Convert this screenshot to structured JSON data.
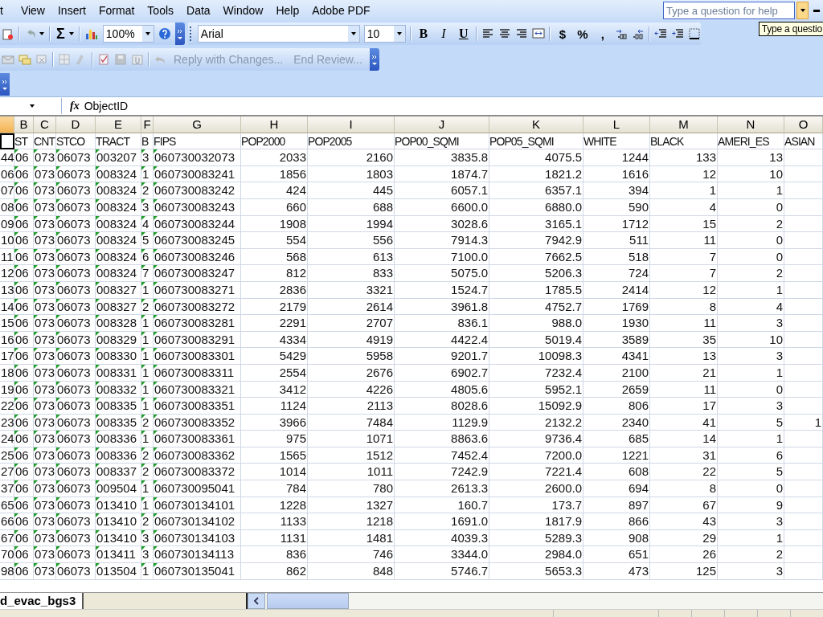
{
  "menu": [
    "t",
    "View",
    "Insert",
    "Format",
    "Tools",
    "Data",
    "Window",
    "Help",
    "Adobe PDF"
  ],
  "help_box": {
    "placeholder": "Type a question for help"
  },
  "tooltip": "Type a questio",
  "standard_toolbar": {
    "sum": "Σ",
    "zoom": "100%"
  },
  "formatting_toolbar": {
    "font": "Arial",
    "size": "10",
    "styles": [
      {
        "label": "B",
        "kind": "bold"
      },
      {
        "label": "I",
        "kind": "italic"
      },
      {
        "label": "U",
        "kind": "underline"
      }
    ],
    "symbols": [
      "$",
      "%",
      ","
    ]
  },
  "review_toolbar": {
    "buttons": [
      {
        "label": "Reply with Changes...",
        "disabled": true
      },
      {
        "label": "End Review...",
        "disabled": true
      }
    ]
  },
  "formula_bar": {
    "function_label": "fx",
    "value": "ObjectID"
  },
  "columns": [
    {
      "selected": true,
      "text_format": false
    },
    {
      "letter": "B",
      "selected": false,
      "text_format": true
    },
    {
      "letter": "C",
      "selected": false,
      "text_format": true
    },
    {
      "letter": "D",
      "selected": false,
      "text_format": true
    },
    {
      "letter": "E",
      "selected": false,
      "text_format": true
    },
    {
      "letter": "F",
      "selected": false,
      "text_format": true
    },
    {
      "letter": "G",
      "selected": false,
      "text_format": true
    },
    {
      "letter": "H",
      "selected": false,
      "text_format": false
    },
    {
      "letter": "I",
      "selected": false,
      "text_format": false
    },
    {
      "letter": "J",
      "selected": false,
      "text_format": false
    },
    {
      "letter": "K",
      "selected": false,
      "text_format": false
    },
    {
      "letter": "L",
      "selected": false,
      "text_format": false
    },
    {
      "letter": "M",
      "selected": false,
      "text_format": false
    },
    {
      "letter": "N",
      "selected": false,
      "text_format": false
    },
    {
      "letter": "O",
      "selected": false,
      "text_format": false
    }
  ],
  "header_row": [
    {
      "selected": true
    },
    {
      "text": "ST",
      "selected": false
    },
    {
      "text": "CNT",
      "selected": false
    },
    {
      "text": "STCO",
      "selected": false
    },
    {
      "text": "TRACT",
      "selected": false
    },
    {
      "text": "B",
      "selected": false
    },
    {
      "text": "FIPS",
      "selected": false
    },
    {
      "text": "POP2000",
      "selected": false
    },
    {
      "text": "POP2005",
      "selected": false
    },
    {
      "text": "POP00_SQMI",
      "selected": false
    },
    {
      "text": "POP05_SQMI",
      "selected": false
    },
    {
      "text": "WHITE",
      "selected": false
    },
    {
      "text": "BLACK",
      "selected": false
    },
    {
      "text": "AMERI_ES",
      "selected": false
    },
    {
      "text": "ASIAN",
      "selected": false
    }
  ],
  "rows": [
    [
      "44",
      "06",
      "073",
      "06073",
      "003207",
      "3",
      "060730032073",
      "2033",
      "2160",
      "3835.8",
      "4075.5",
      "1244",
      "133",
      "13"
    ],
    [
      "06",
      "06",
      "073",
      "06073",
      "008324",
      "1",
      "060730083241",
      "1856",
      "1803",
      "1874.7",
      "1821.2",
      "1616",
      "12",
      "10"
    ],
    [
      "07",
      "06",
      "073",
      "06073",
      "008324",
      "2",
      "060730083242",
      "424",
      "445",
      "6057.1",
      "6357.1",
      "394",
      "1",
      "1"
    ],
    [
      "08",
      "06",
      "073",
      "06073",
      "008324",
      "3",
      "060730083243",
      "660",
      "688",
      "6600.0",
      "6880.0",
      "590",
      "4",
      "0"
    ],
    [
      "09",
      "06",
      "073",
      "06073",
      "008324",
      "4",
      "060730083244",
      "1908",
      "1994",
      "3028.6",
      "3165.1",
      "1712",
      "15",
      "2"
    ],
    [
      "10",
      "06",
      "073",
      "06073",
      "008324",
      "5",
      "060730083245",
      "554",
      "556",
      "7914.3",
      "7942.9",
      "511",
      "11",
      "0"
    ],
    [
      "11",
      "06",
      "073",
      "06073",
      "008324",
      "6",
      "060730083246",
      "568",
      "613",
      "7100.0",
      "7662.5",
      "518",
      "7",
      "0"
    ],
    [
      "12",
      "06",
      "073",
      "06073",
      "008324",
      "7",
      "060730083247",
      "812",
      "833",
      "5075.0",
      "5206.3",
      "724",
      "7",
      "2"
    ],
    [
      "13",
      "06",
      "073",
      "06073",
      "008327",
      "1",
      "060730083271",
      "2836",
      "3321",
      "1524.7",
      "1785.5",
      "2414",
      "12",
      "1"
    ],
    [
      "14",
      "06",
      "073",
      "06073",
      "008327",
      "2",
      "060730083272",
      "2179",
      "2614",
      "3961.8",
      "4752.7",
      "1769",
      "8",
      "4"
    ],
    [
      "15",
      "06",
      "073",
      "06073",
      "008328",
      "1",
      "060730083281",
      "2291",
      "2707",
      "836.1",
      "988.0",
      "1930",
      "11",
      "3"
    ],
    [
      "16",
      "06",
      "073",
      "06073",
      "008329",
      "1",
      "060730083291",
      "4334",
      "4919",
      "4422.4",
      "5019.4",
      "3589",
      "35",
      "10"
    ],
    [
      "17",
      "06",
      "073",
      "06073",
      "008330",
      "1",
      "060730083301",
      "5429",
      "5958",
      "9201.7",
      "10098.3",
      "4341",
      "13",
      "3"
    ],
    [
      "18",
      "06",
      "073",
      "06073",
      "008331",
      "1",
      "060730083311",
      "2554",
      "2676",
      "6902.7",
      "7232.4",
      "2100",
      "21",
      "1"
    ],
    [
      "19",
      "06",
      "073",
      "06073",
      "008332",
      "1",
      "060730083321",
      "3412",
      "4226",
      "4805.6",
      "5952.1",
      "2659",
      "11",
      "0"
    ],
    [
      "22",
      "06",
      "073",
      "06073",
      "008335",
      "1",
      "060730083351",
      "1124",
      "2113",
      "8028.6",
      "15092.9",
      "806",
      "17",
      "3"
    ],
    [
      "23",
      "06",
      "073",
      "06073",
      "008335",
      "2",
      "060730083352",
      "3966",
      "7484",
      "1129.9",
      "2132.2",
      "2340",
      "41",
      "5",
      "1"
    ],
    [
      "24",
      "06",
      "073",
      "06073",
      "008336",
      "1",
      "060730083361",
      "975",
      "1071",
      "8863.6",
      "9736.4",
      "685",
      "14",
      "1"
    ],
    [
      "25",
      "06",
      "073",
      "06073",
      "008336",
      "2",
      "060730083362",
      "1565",
      "1512",
      "7452.4",
      "7200.0",
      "1221",
      "31",
      "6"
    ],
    [
      "27",
      "06",
      "073",
      "06073",
      "008337",
      "2",
      "060730083372",
      "1014",
      "1011",
      "7242.9",
      "7221.4",
      "608",
      "22",
      "5"
    ],
    [
      "37",
      "06",
      "073",
      "06073",
      "009504",
      "1",
      "060730095041",
      "784",
      "780",
      "2613.3",
      "2600.0",
      "694",
      "8",
      "0"
    ],
    [
      "65",
      "06",
      "073",
      "06073",
      "013410",
      "1",
      "060730134101",
      "1228",
      "1327",
      "160.7",
      "173.7",
      "897",
      "67",
      "9"
    ],
    [
      "66",
      "06",
      "073",
      "06073",
      "013410",
      "2",
      "060730134102",
      "1133",
      "1218",
      "1691.0",
      "1817.9",
      "866",
      "43",
      "3"
    ],
    [
      "67",
      "06",
      "073",
      "06073",
      "013410",
      "3",
      "060730134103",
      "1131",
      "1481",
      "4039.3",
      "5289.3",
      "908",
      "29",
      "1"
    ],
    [
      "70",
      "06",
      "073",
      "06073",
      "013411",
      "3",
      "060730134113",
      "836",
      "746",
      "3344.0",
      "2984.0",
      "651",
      "26",
      "2"
    ],
    [
      "98",
      "06",
      "073",
      "06073",
      "013504",
      "1",
      "060730135041",
      "862",
      "848",
      "5746.7",
      "5653.3",
      "473",
      "125",
      "3"
    ]
  ],
  "sheet_tabs": [
    {
      "label": "d_evac_bgs3",
      "selected": true
    }
  ]
}
